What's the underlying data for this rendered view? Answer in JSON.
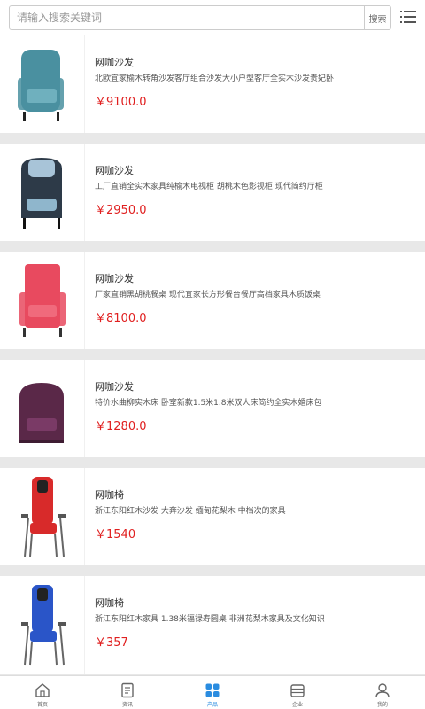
{
  "search": {
    "placeholder": "请输入搜索关键词",
    "button_label": "搜索"
  },
  "products": [
    {
      "title": "网咖沙发",
      "desc": "北欧宜家榆木转角沙发客厅组合沙发大小户型客厅全实木沙发贵妃卧",
      "price": "￥9100.0",
      "color": "#4a90a0"
    },
    {
      "title": "网咖沙发",
      "desc": "工厂直销全实木家具纯榆木电视柜 胡桃木色影视柜 现代简约厅柜",
      "price": "￥2950.0",
      "color": "#2d3a48"
    },
    {
      "title": "网咖沙发",
      "desc": "厂家直销黑胡桃餐桌 现代宜家长方形餐台餐厅高档家具木质饭桌",
      "price": "￥8100.0",
      "color": "#e84a5f"
    },
    {
      "title": "网咖沙发",
      "desc": "特价水曲柳实木床 卧室新款1.5米1.8米双人床简约全实木婚床包",
      "price": "￥1280.0",
      "color": "#5a2848"
    },
    {
      "title": "网咖椅",
      "desc": "浙江东阳红木沙发 大奔沙发 缅甸花梨木 中档次的家具",
      "price": "￥1540",
      "color": "#d82a2a"
    },
    {
      "title": "网咖椅",
      "desc": "浙江东阳红木家具 1.38米福禄寿圆桌 非洲花梨木家具及文化知识",
      "price": "￥357",
      "color": "#2a55c8"
    }
  ],
  "tabs": [
    {
      "label": "首页",
      "icon": "home-icon"
    },
    {
      "label": "资讯",
      "icon": "news-icon"
    },
    {
      "label": "产品",
      "icon": "products-icon",
      "active": true
    },
    {
      "label": "企业",
      "icon": "company-icon"
    },
    {
      "label": "我的",
      "icon": "user-icon"
    }
  ],
  "colors": {
    "accent": "#2a8ce0",
    "price": "#e02020"
  }
}
